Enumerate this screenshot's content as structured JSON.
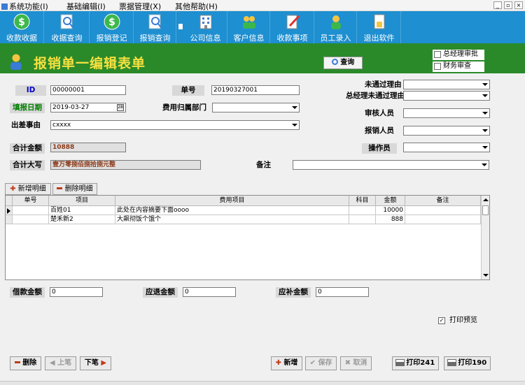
{
  "menu": {
    "items": [
      "系统功能(I)",
      "基础编辑(I)",
      "票据管理(X)",
      "其他帮助(H)"
    ],
    "window_controls": [
      "_",
      "▫",
      "×"
    ]
  },
  "toolbar": {
    "buttons": [
      "收款收据",
      "收据查询",
      "报销登记",
      "报销查询",
      "公司信息",
      "客户信息",
      "收款事项",
      "员工录入",
      "退出软件"
    ]
  },
  "header": {
    "title": "报销单一编辑表单",
    "query_button": "查询",
    "options": [
      "总经理审批",
      "财务审查"
    ],
    "accent_color": "#2a8a2a",
    "title_color": "#f7e040"
  },
  "form": {
    "id_label": "ID",
    "id_value": "00000001",
    "no_label": "单号",
    "no_value": "20190327001",
    "date_label": "填报日期",
    "date_value": "2019-03-27",
    "dept_label": "费用归属部门",
    "dept_value": "",
    "reason_label": "出差事由",
    "reason_value": "cxxxx",
    "total_label": "合计金额",
    "total_value": "10888",
    "total_upper_label": "合计大写",
    "total_upper_value": "壹万零捌佰捌拾捌元整",
    "remark_label": "备注",
    "remark_value": "",
    "reject_label": "未通过理由",
    "gm_reject_label": "总经理未通过理由",
    "approver_label": "审核人员",
    "claimant_label": "报销人员",
    "operator_label": "操作员"
  },
  "detail": {
    "add_tab": "新增明细",
    "delete_tab": "删除明细",
    "columns": [
      "单号",
      "项目",
      "费用项目",
      "科目",
      "金额",
      "备注"
    ],
    "rows": [
      {
        "no": "",
        "item": "百姓01",
        "fee": "此处在内容摘要下面oooo",
        "subject": "",
        "amount": "10000",
        "remark": ""
      },
      {
        "no": "",
        "item": "楚禾新2",
        "fee": "大飙彻饭个饿个",
        "subject": "",
        "amount": "888",
        "remark": ""
      }
    ]
  },
  "amounts": {
    "loan_label": "借款金额",
    "loan_value": "0",
    "refund_label": "应退金额",
    "refund_value": "0",
    "supplement_label": "应补金额",
    "supplement_value": "0",
    "print_preview_label": "打印预览"
  },
  "footer": {
    "delete": "删除",
    "prev": "上笔",
    "next": "下笔",
    "add": "新增",
    "save": "保存",
    "cancel": "取消",
    "print1": "打印241",
    "print2": "打印190"
  }
}
